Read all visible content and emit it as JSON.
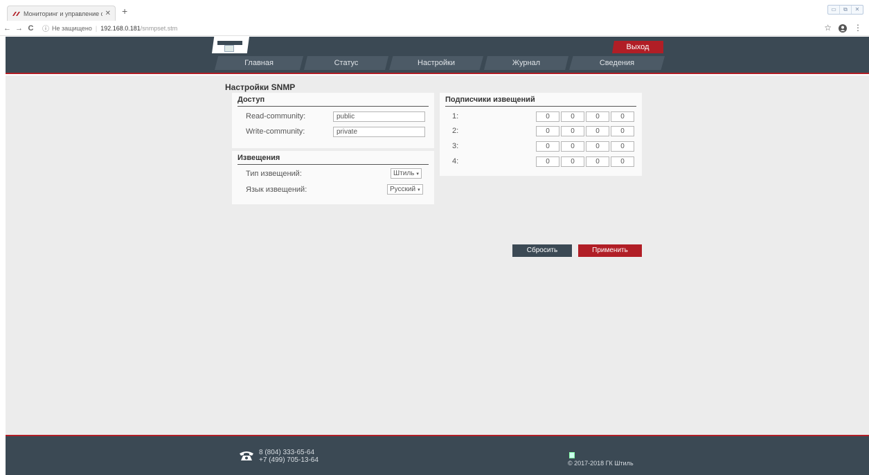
{
  "browser": {
    "tab_title": "Мониторинг и управление сист",
    "tab_close": "✕",
    "new_tab": "+",
    "win_controls": [
      "▭",
      "⧉",
      "✕"
    ],
    "nav": {
      "back": "←",
      "forward": "→",
      "reload": "C"
    },
    "security_icon": "ⓘ",
    "security_label": "Не защищено",
    "url_host": "192.168.0.181",
    "url_path": "/snmpset.stm",
    "bookmark_icon": "☆",
    "profile_icon": "👤",
    "menu_icon": "⋮"
  },
  "header": {
    "logout_label": "Выход",
    "menu": [
      "Главная",
      "Статус",
      "Настройки",
      "Журнал",
      "Сведения"
    ]
  },
  "page": {
    "title": "Настройки SNMP",
    "access": {
      "title": "Доступ",
      "read_label": "Read-community:",
      "read_value": "public",
      "write_label": "Write-community:",
      "write_value": "private"
    },
    "notifications": {
      "title": "Извещения",
      "type_label": "Тип извещений:",
      "type_value": "Штиль",
      "lang_label": "Язык извещений:",
      "lang_value": "Русский",
      "caret": "▾"
    },
    "subscribers": {
      "title": "Подписчики извещений",
      "rows": [
        {
          "label": "1:",
          "ip": [
            "0",
            "0",
            "0",
            "0"
          ]
        },
        {
          "label": "2:",
          "ip": [
            "0",
            "0",
            "0",
            "0"
          ]
        },
        {
          "label": "3:",
          "ip": [
            "0",
            "0",
            "0",
            "0"
          ]
        },
        {
          "label": "4:",
          "ip": [
            "0",
            "0",
            "0",
            "0"
          ]
        }
      ]
    },
    "reset_label": "Сбросить",
    "apply_label": "Применить"
  },
  "footer": {
    "phone1": "8 (804) 333-65-64",
    "phone2": "+7 (499) 705-13-64",
    "copyright": "© 2017-2018 ГК Штиль"
  },
  "colors": {
    "header_bg": "#3b4954",
    "accent_red": "#b11e26",
    "main_bg": "#ececec"
  }
}
